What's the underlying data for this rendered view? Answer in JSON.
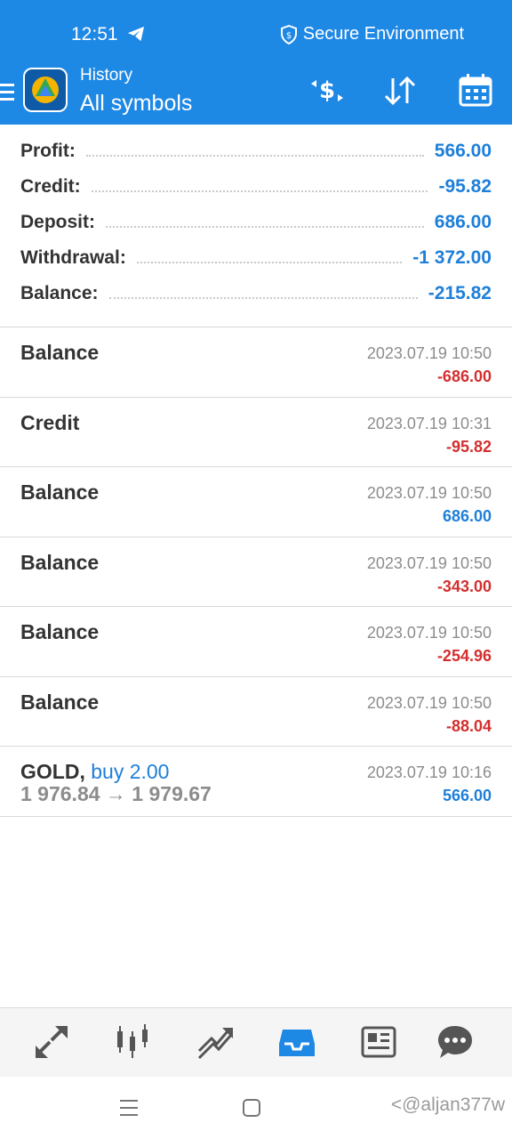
{
  "status_bar": {
    "time": "12:51",
    "secure_label": "Secure Environment"
  },
  "app_bar": {
    "subtitle": "History",
    "title": "All symbols",
    "icons": [
      "menu-icon",
      "app-logo",
      "currency-exchange-icon",
      "sort-icon",
      "calendar-icon"
    ]
  },
  "summary": [
    {
      "label": "Profit:",
      "value": "566.00"
    },
    {
      "label": "Credit:",
      "value": "-95.82"
    },
    {
      "label": "Deposit:",
      "value": "686.00"
    },
    {
      "label": "Withdrawal:",
      "value": "-1 372.00"
    },
    {
      "label": "Balance:",
      "value": "-215.82"
    }
  ],
  "deals": [
    {
      "name": "Balance",
      "time": "2023.07.19 10:50",
      "amount": "-686.00"
    },
    {
      "name": "Credit",
      "time": "2023.07.19 10:31",
      "amount": "-95.82"
    },
    {
      "name": "Balance",
      "time": "2023.07.19 10:50",
      "amount": "686.00"
    },
    {
      "name": "Balance",
      "time": "2023.07.19 10:50",
      "amount": "-343.00"
    },
    {
      "name": "Balance",
      "time": "2023.07.19 10:50",
      "amount": "-254.96"
    },
    {
      "name": "Balance",
      "time": "2023.07.19 10:50",
      "amount": "-88.04"
    }
  ],
  "trade": {
    "symbol": "GOLD,",
    "action": "buy 2.00",
    "prices": "1 976.84 → 1 979.67",
    "time": "2023.07.19 10:16",
    "amount": "566.00"
  },
  "bottom_nav": [
    "quotes-icon",
    "chart-icon",
    "trade-icon",
    "history-icon",
    "news-icon",
    "messages-icon"
  ],
  "watermark": "<@aljan377w",
  "colors": {
    "header": "#1e88e5",
    "positive": "#1e7fd9",
    "negative": "#d32f2f",
    "active_nav": "#1e88e5"
  }
}
